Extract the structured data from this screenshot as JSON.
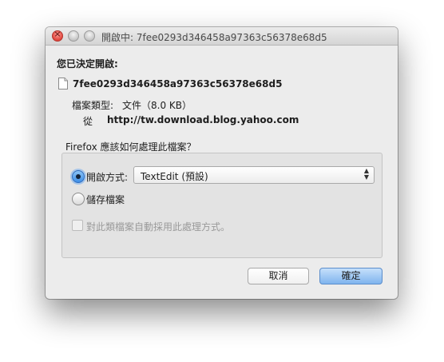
{
  "window": {
    "title": "開啟中: 7fee0293d346458a97363c56378e68d5"
  },
  "dialog": {
    "heading": "您已決定開啟:",
    "file_name": "7fee0293d346458a97363c56378e68d5",
    "file_icon": "document-icon",
    "type_label": "檔案類型:",
    "type_value": "文件（8.0 KB）",
    "from_label": "從",
    "from_value": "http://tw.download.blog.yahoo.com",
    "question": "Firefox 應該如何處理此檔案？",
    "options": {
      "open_with_label": "開啟方式:",
      "open_with_selected": true,
      "app_value": "TextEdit (預設)",
      "save_label": "儲存檔案",
      "save_selected": false,
      "remember_label": "對此類檔案自動採用此處理方式。",
      "remember_checked": false
    },
    "buttons": {
      "cancel": "取消",
      "ok": "確定"
    }
  },
  "colors": {
    "window_bg": "#ececec",
    "accent": "#3f8ee6",
    "close": "#e0453c"
  }
}
